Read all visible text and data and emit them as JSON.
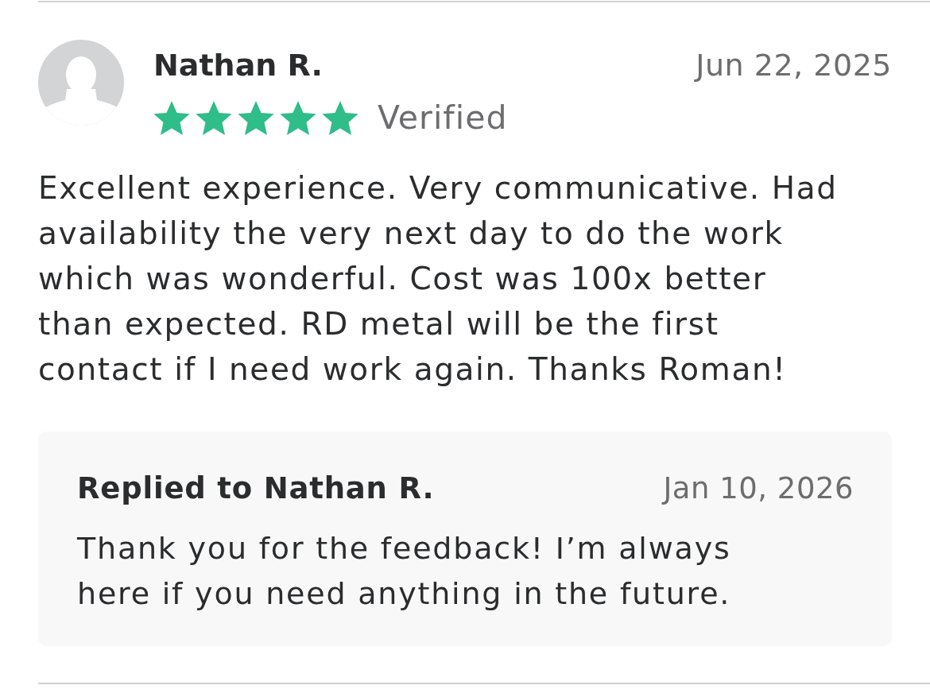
{
  "review": {
    "author": "Nathan R.",
    "date": "Jun 22, 2025",
    "stars": 5,
    "badge": "Verified",
    "text": "Excellent experience. Very communicative. Had availability the very next day to do the work which was wonderful. Cost was 100x better than expected. RD metal will be the first contact if I need work again. Thanks Roman!"
  },
  "reply": {
    "title": "Replied to Nathan R.",
    "date": "Jan 10, 2026",
    "text": "Thank you for the feedback! I’m always here if you need anything in the future."
  }
}
